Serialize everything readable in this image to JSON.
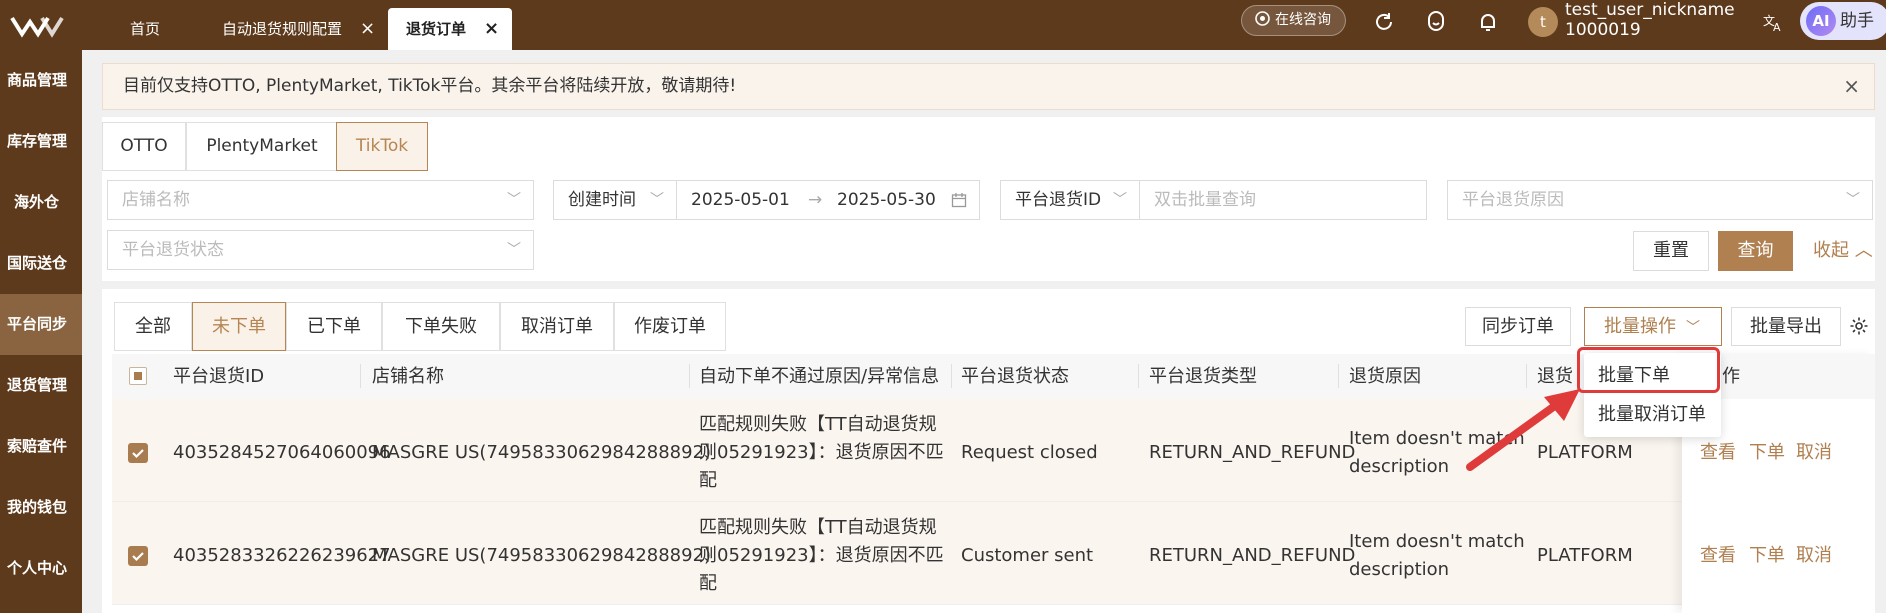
{
  "topbar": {
    "tabs": [
      {
        "label": "首页",
        "closable": false
      },
      {
        "label": "自动退货规则配置",
        "closable": true
      },
      {
        "label": "退货订单",
        "closable": true,
        "active": true
      }
    ],
    "close_glyph": "×",
    "consult_label": "在线咨询",
    "user_initial": "t",
    "user_name": "test_user_nickname",
    "user_id": "1000019",
    "ai_badge": "AI",
    "ai_label": "助手"
  },
  "sidebar": {
    "items": [
      {
        "label": "商品管理"
      },
      {
        "label": "库存管理"
      },
      {
        "label": "海外仓"
      },
      {
        "label": "国际送仓"
      },
      {
        "label": "平台同步",
        "active": true
      },
      {
        "label": "退货管理"
      },
      {
        "label": "索赔查件"
      },
      {
        "label": "我的钱包"
      },
      {
        "label": "个人中心"
      }
    ]
  },
  "notice": {
    "text": "目前仅支持OTTO, PlentyMarket, TikTok平台。其余平台将陆续开放，敬请期待!",
    "close_glyph": "×"
  },
  "platform_tabs": [
    "OTTO",
    "PlentyMarket",
    "TikTok"
  ],
  "filters": {
    "store_placeholder": "店铺名称",
    "date_type": "创建时间",
    "date_start": "2025-05-01",
    "date_arrow": "→",
    "date_end": "2025-05-30",
    "id_type": "平台退货ID",
    "id_placeholder": "双击批量查询",
    "reason_placeholder": "平台退货原因",
    "status_placeholder": "平台退货状态",
    "reset_label": "重置",
    "query_label": "查询",
    "collapse_label": "收起"
  },
  "status_tabs": [
    "全部",
    "未下单",
    "已下单",
    "下单失败",
    "取消订单",
    "作废订单"
  ],
  "actions": {
    "sync_label": "同步订单",
    "batch_label": "批量操作",
    "export_label": "批量导出"
  },
  "table": {
    "headers": [
      "平台退货ID",
      "店铺名称",
      "自动下单不通过原因/异常信息",
      "平台退货状态",
      "平台退货类型",
      "退货原因",
      "退货"
    ],
    "op_header": "作",
    "rows": [
      {
        "id": "4035284527064060096",
        "store": "MASGRE US(7495833062984288892)",
        "reason_lines": [
          "匹配规则失败【TT自动退货规",
          "则05291923】：退货原因不匹",
          "配"
        ],
        "status": "Request closed",
        "type": "RETURN_AND_REFUND",
        "return_reason_lines": [
          "Item doesn't match",
          "description"
        ],
        "source": "PLATFORM",
        "checked": true
      },
      {
        "id": "4035283326226239627",
        "store": "MASGRE US(7495833062984288892)",
        "reason_lines": [
          "匹配规则失败【TT自动退货规",
          "则05291923】：退货原因不匹",
          "配"
        ],
        "status": "Customer sent",
        "type": "RETURN_AND_REFUND",
        "return_reason_lines": [
          "Item doesn't match",
          "description"
        ],
        "source": "PLATFORM",
        "checked": true
      }
    ],
    "ops": [
      "查看",
      "下单",
      "取消"
    ]
  },
  "dropdown": {
    "items": [
      "批量下单",
      "批量取消订单"
    ]
  },
  "colors": {
    "brand_brown": "#5e3a1c",
    "accent": "#b08050",
    "highlight_red": "#e03b3b"
  }
}
